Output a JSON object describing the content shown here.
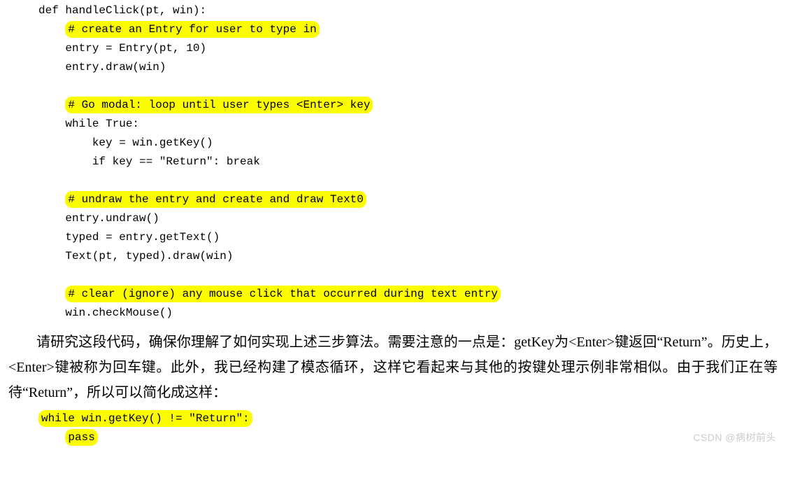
{
  "code": {
    "def_line": "def handleClick(pt, win):",
    "c1": "# create an Entry for user to type in",
    "l1": "entry = Entry(pt, 10)",
    "l2": "entry.draw(win)",
    "c2": "# Go modal: loop until user types <Enter> key",
    "l3": "while True:",
    "l4": "key = win.getKey()",
    "l5": "if key == \"Return\": break",
    "c3": "# undraw the entry and create and draw Text0",
    "l6": "entry.undraw()",
    "l7": "typed = entry.getText()",
    "l8": "Text(pt, typed).draw(win)",
    "c4": "# clear (ignore) any mouse click that occurred during text entry",
    "l9": "win.checkMouse()"
  },
  "paragraph": {
    "p1": "请研究这段代码，确保你理解了如何实现上述三步算法。需要注意的一点是：getKey为<Enter>键返回“Return”。历史上，<Enter>键被称为回车键。此外，我已经构建了模态循环，这样它看起来与其他的按键处理示例非常相似。由于我们正在等待“Return”，所以可以简化成这样："
  },
  "code2": {
    "w1": "while win.getKey() != \"Return\":",
    "w2": "pass"
  },
  "watermark": "CSDN @病树前头"
}
